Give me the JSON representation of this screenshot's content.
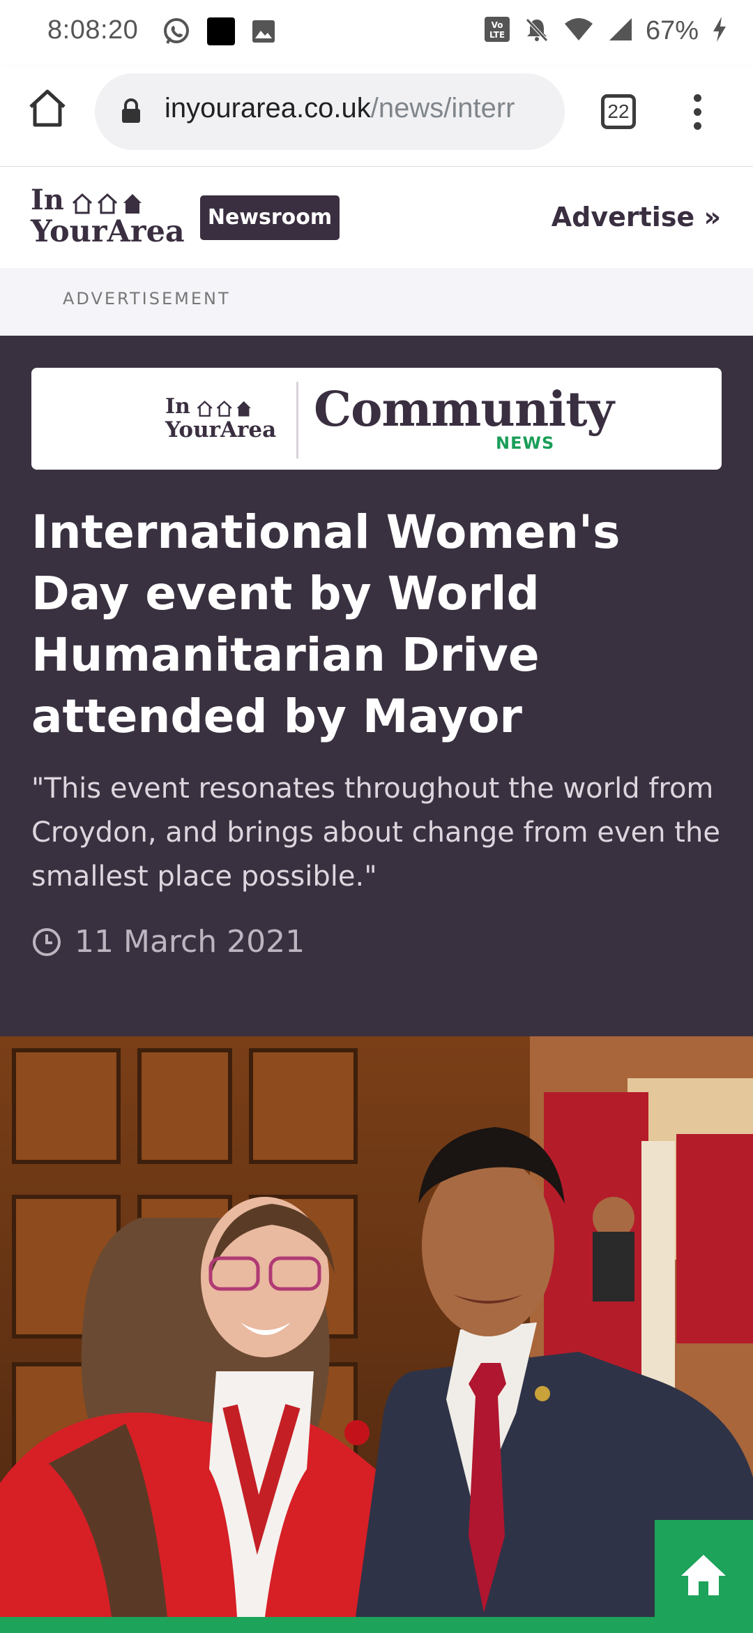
{
  "status_bar": {
    "time": "8:08:20",
    "battery": "67%"
  },
  "browser": {
    "url_host": "inyourarea.co.uk",
    "url_path": "/news/interr",
    "tab_count": "22"
  },
  "site": {
    "logo_line1": "In",
    "logo_line2": "YourArea",
    "newsroom_label": "Newsroom",
    "advertise_label": "Advertise »"
  },
  "ad_label": "ADVERTISEMENT",
  "banner": {
    "logo_line1": "In",
    "logo_line2": "YourArea",
    "title": "Community",
    "subtitle": "NEWS"
  },
  "article": {
    "headline": "International Women's Day event by World Humanitarian Drive attended by Mayor",
    "standfirst": "\"This event resonates throughout the world from Croydon, and brings about change from even the smallest place possible.\"",
    "date": "11 March 2021"
  },
  "colors": {
    "brand_dark": "#3a2f40",
    "accent_green": "#1da35a"
  }
}
